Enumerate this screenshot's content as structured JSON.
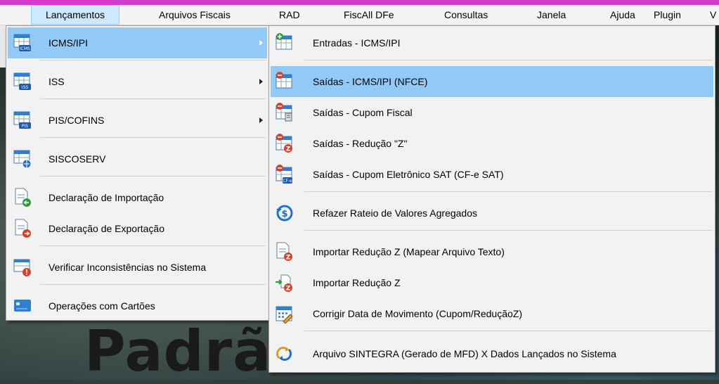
{
  "menubar": {
    "items": [
      "Lançamentos",
      "Arquivos Fiscais",
      "RAD",
      "FiscAll DFe",
      "Consultas",
      "Janela",
      "Ajuda",
      "Plugin",
      "V"
    ]
  },
  "background": {
    "text": "Padrãc"
  },
  "menu_left": {
    "items": [
      {
        "label": "ICMS/IPI",
        "icon": "table-icms-icon",
        "submenu": true,
        "highlighted": true
      },
      {
        "label": "ISS",
        "icon": "table-iss-icon",
        "submenu": true
      },
      {
        "label": "PIS/COFINS",
        "icon": "table-pis-icon",
        "submenu": true
      },
      {
        "label": "SISCOSERV",
        "icon": "table-globe-icon",
        "submenu": false
      },
      {
        "label": "Declaração de Importação",
        "icon": "doc-import-icon"
      },
      {
        "label": "Declaração de Exportação",
        "icon": "doc-export-icon"
      },
      {
        "label": "Verificar Inconsistências no Sistema",
        "icon": "table-warning-icon"
      },
      {
        "label": "Operações com Cartões",
        "icon": "card-icon"
      }
    ]
  },
  "menu_right": {
    "items": [
      {
        "label": "Entradas - ICMS/IPI",
        "icon": "entry-table-icon"
      },
      {
        "label": "Saídas - ICMS/IPI (NFCE)",
        "icon": "exit-table-icon",
        "highlighted": true
      },
      {
        "label": "Saídas - Cupom Fiscal",
        "icon": "exit-coupon-icon"
      },
      {
        "label": "Saídas - Redução \"Z\"",
        "icon": "exit-z-icon"
      },
      {
        "label": "Saídas - Cupom Eletrônico SAT (CF-e SAT)",
        "icon": "exit-sat-icon"
      },
      {
        "label": "Refazer Rateio de Valores Agregados",
        "icon": "refresh-dollar-icon"
      },
      {
        "label": "Importar Redução Z (Mapear Arquivo Texto)",
        "icon": "doc-z-icon"
      },
      {
        "label": "Importar Redução Z",
        "icon": "import-z-icon"
      },
      {
        "label": "Corrigir Data de Movimento (Cupom/ReduçãoZ)",
        "icon": "calendar-edit-icon"
      },
      {
        "label": "Arquivo SINTEGRA (Gerado de MFD) X Dados Lançados no Sistema",
        "icon": "sync-icon"
      }
    ]
  },
  "colors": {
    "highlight": "#91c9f7",
    "menubar_active": "#cde8ff",
    "accent_bar": "#d23ad0"
  }
}
